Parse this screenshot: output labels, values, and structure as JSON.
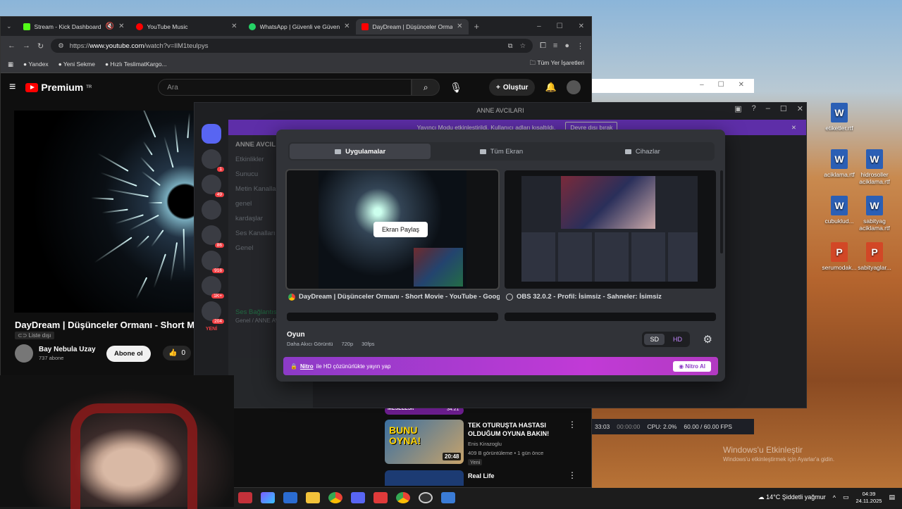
{
  "browser": {
    "tabs": [
      {
        "label": "Stream - Kick Dashboard",
        "color": "#53fc18"
      },
      {
        "label": "YouTube Music",
        "color": "#ff0000"
      },
      {
        "label": "WhatsApp | Güvenli ve Güvenilir",
        "color": "#25d366"
      },
      {
        "label": "DayDream | Düşünceler Ormanı",
        "color": "#ff0000"
      }
    ],
    "url_prefix": "https://",
    "url_host": "www.youtube.com",
    "url_path": "/watch?v=IlM1teulpys",
    "bookmarks": [
      "Yandex",
      "Yeni Sekme",
      "Hızlı TeslimatKargo..."
    ],
    "all_bookmarks": "Tüm Yer İşaretleri"
  },
  "youtube": {
    "logo": "Premium",
    "logo_sup": "TR",
    "search_placeholder": "Ara",
    "create_label": "Oluştur",
    "video_title": "DayDream | Düşünceler Ormanı - Short Movie",
    "list_badge": "Liste dışı",
    "channel": "Bay Nebula Uzay",
    "subs": "737 abone",
    "subscribe": "Abone ol",
    "likes": "0",
    "recs": [
      {
        "title": "MESELESI!",
        "duration": "34:21"
      },
      {
        "title": "TEK OTURUŞTA HASTASI OLDUĞUM OYUNA BAKIN!",
        "channel": "Enis Kirazoglu",
        "meta": "409 B görüntüleme • 1 gün önce",
        "badge": "Yeni",
        "duration": "20:48",
        "thumb_text": "BUNU OYNA!"
      },
      {
        "title": "Real Life"
      }
    ]
  },
  "discord": {
    "window_title": "ANNE AVCILARI",
    "banner_text": "Yayıncı Modu etkinleştirildi. Kullanıcı adları kısaltıldı.",
    "banner_button": "Devre dışı bırak",
    "server_name": "ANNE AVCIL",
    "channels": [
      "Etkinlikler",
      "Sunucu",
      "Metin Kanalları",
      "genel",
      "kardaşlar",
      "Ses Kanalları",
      "Genel"
    ],
    "server_counts": [
      "1",
      "49",
      "86",
      "916",
      "1K+",
      "204"
    ],
    "new_badge": "YENİ",
    "voice_status": "Ses Bağlantısı Kuruldu",
    "voice_sub": "Genel / ANNE AVCILARI"
  },
  "share_modal": {
    "tabs": [
      {
        "label": "Uygulamalar",
        "selected": true
      },
      {
        "label": "Tüm Ekran",
        "selected": false
      },
      {
        "label": "Cihazlar",
        "selected": false
      }
    ],
    "share_button": "Ekran Paylaş",
    "windows": [
      {
        "label": "DayDream | Düşünceler Ormanı - Short Movie - YouTube - Google Ch...",
        "icon": "chrome-icon"
      },
      {
        "label": "OBS 32.0.2 - Profil: İsimsiz - Sahneler: İsimsiz",
        "icon": "obs-icon"
      }
    ],
    "game_title": "Oyun",
    "game_sub": "Daha Akıcı Görüntü",
    "resolution": "720p",
    "fps": "30fps",
    "sd": "SD",
    "hd": "HD",
    "nitro_brand": "Nitro",
    "nitro_text": "ile HD çözünürlükte yayın yap",
    "nitro_button": "Nitro Al"
  },
  "obs": {
    "time1": "33:03",
    "time2": "00:00:00",
    "cpu": "CPU: 2.0%",
    "fps": "60.00 / 60.00 FPS"
  },
  "desktop": {
    "icons": [
      "etiketler.rtf",
      "aciklama.rtf",
      "hidrosoller aciklama.rtf",
      "cubuklud...",
      "sabityag aciklama.rtf",
      "serumodak...",
      "sabityaglar..."
    ],
    "watermark_title": "Windows'u Etkinleştir",
    "watermark_sub": "Windows'u etkinleştirmek için Ayarlar'a gidin."
  },
  "taskbar": {
    "weather": "14°C  Şiddetli yağmur",
    "time": "04:39",
    "date": "24.11.2025"
  }
}
